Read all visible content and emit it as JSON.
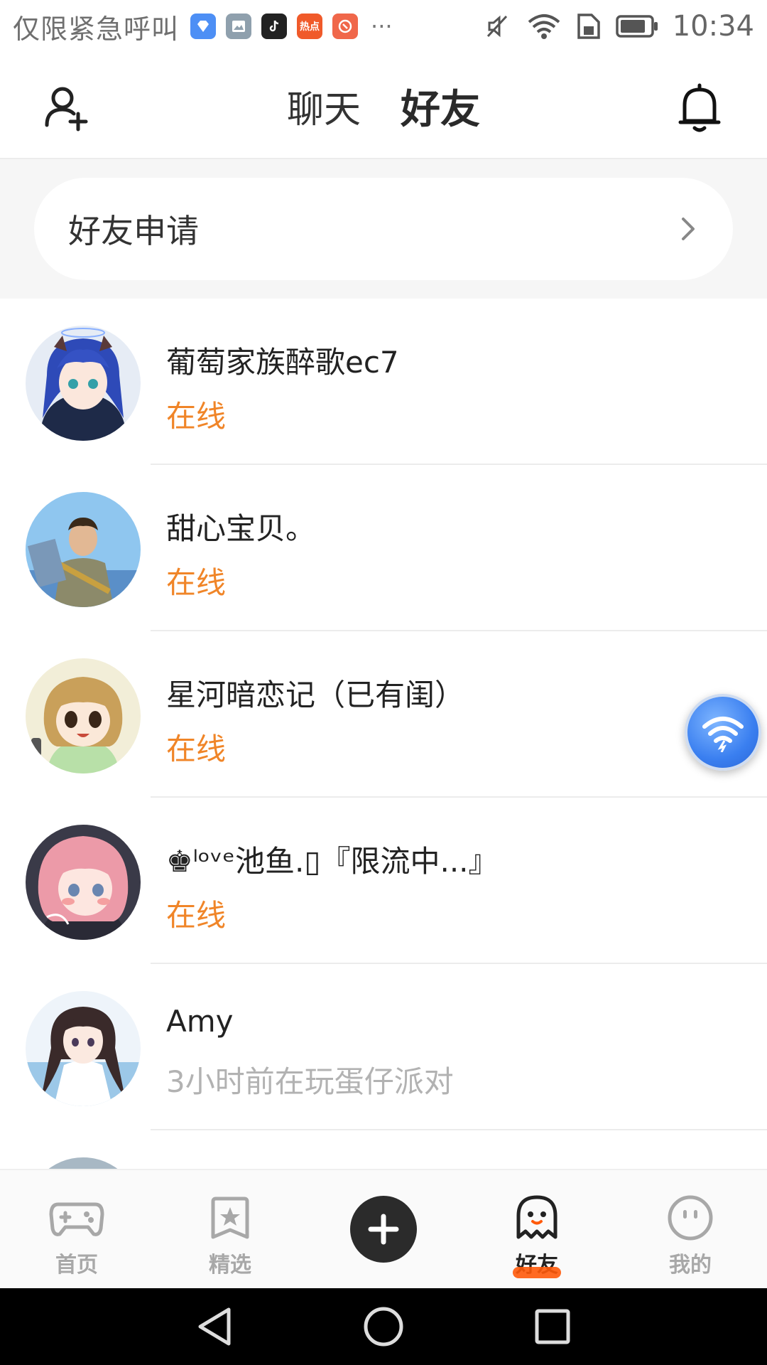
{
  "status_bar": {
    "carrier": "仅限紧急呼叫",
    "app_icons": [
      {
        "name": "diamond-app-icon",
        "color": "#4d8ff5"
      },
      {
        "name": "gallery-app-icon",
        "color": "#8fa0ad"
      },
      {
        "name": "tiktok-app-icon",
        "color": "#222222"
      },
      {
        "name": "hot-news-app-icon",
        "color": "#f05a2a",
        "text": "热点"
      },
      {
        "name": "red-app-icon",
        "color": "#f0674a"
      }
    ],
    "more": "···",
    "time": "10:34"
  },
  "header": {
    "tabs": [
      {
        "label": "聊天",
        "active": false
      },
      {
        "label": "好友",
        "active": true
      }
    ],
    "accent": "#ff5a0a"
  },
  "friend_request": {
    "label": "好友申请"
  },
  "friends": [
    {
      "name": "葡萄家族醉歌ec7",
      "status": "在线",
      "online": true
    },
    {
      "name": "甜心宝贝。",
      "status": "在线",
      "online": true
    },
    {
      "name": "星河暗恋记（已有闺）",
      "status": "在线",
      "online": true
    },
    {
      "name": "♚ˡᵒᵛᵉ池鱼.▯『限流中...』",
      "status": "在线",
      "online": true
    },
    {
      "name": "Amy",
      "status": "3小时前在玩蛋仔派对",
      "online": false
    }
  ],
  "bottom_nav": [
    {
      "label": "首页",
      "icon": "gamepad-icon",
      "active": false
    },
    {
      "label": "精选",
      "icon": "star-bookmark-icon",
      "active": false
    },
    {
      "label": "",
      "icon": "plus-icon",
      "active": false
    },
    {
      "label": "好友",
      "icon": "ghost-icon",
      "active": true
    },
    {
      "label": "我的",
      "icon": "face-icon",
      "active": false
    }
  ]
}
